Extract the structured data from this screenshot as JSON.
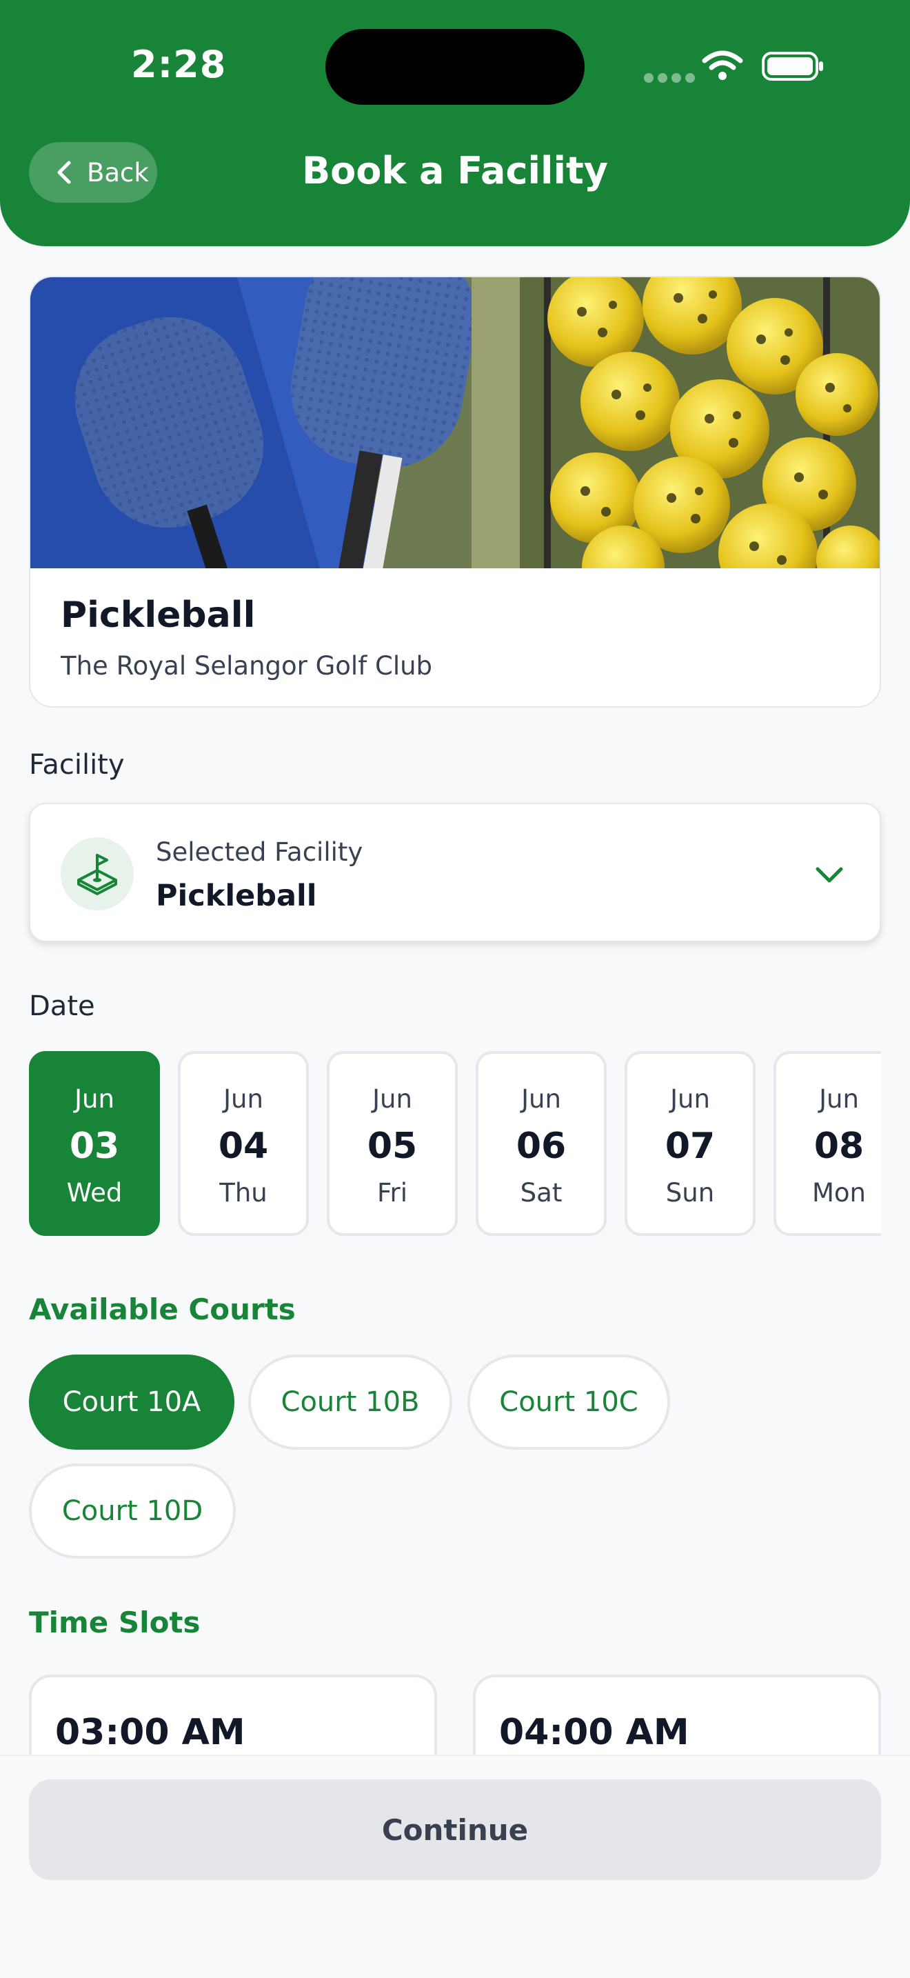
{
  "status_bar": {
    "time": "2:28"
  },
  "header": {
    "back_label": "Back",
    "title": "Book a Facility"
  },
  "hero": {
    "name": "Pickleball",
    "venue": "The Royal Selangor Golf Club"
  },
  "facility": {
    "section_label": "Facility",
    "small_label": "Selected Facility",
    "value": "Pickleball",
    "icon": "golf-flag-course-icon"
  },
  "date": {
    "section_label": "Date",
    "chips": [
      {
        "month": "Jun",
        "day": "03",
        "weekday": "Wed",
        "selected": true
      },
      {
        "month": "Jun",
        "day": "04",
        "weekday": "Thu",
        "selected": false
      },
      {
        "month": "Jun",
        "day": "05",
        "weekday": "Fri",
        "selected": false
      },
      {
        "month": "Jun",
        "day": "06",
        "weekday": "Sat",
        "selected": false
      },
      {
        "month": "Jun",
        "day": "07",
        "weekday": "Sun",
        "selected": false
      },
      {
        "month": "Jun",
        "day": "08",
        "weekday": "Mon",
        "selected": false
      }
    ]
  },
  "courts": {
    "section_label": "Available Courts",
    "items": [
      {
        "label": "Court 10A",
        "selected": true
      },
      {
        "label": "Court 10B",
        "selected": false
      },
      {
        "label": "Court 10C",
        "selected": false
      },
      {
        "label": "Court 10D",
        "selected": false
      }
    ]
  },
  "time_slots": {
    "section_label": "Time Slots",
    "items": [
      {
        "time": "03:00 AM"
      },
      {
        "time": "04:00 AM"
      }
    ]
  },
  "footer": {
    "continue_label": "Continue"
  },
  "colors": {
    "brand_green": "#178437",
    "background": "#f8f9fb",
    "disabled_button": "#e5e6e9"
  }
}
